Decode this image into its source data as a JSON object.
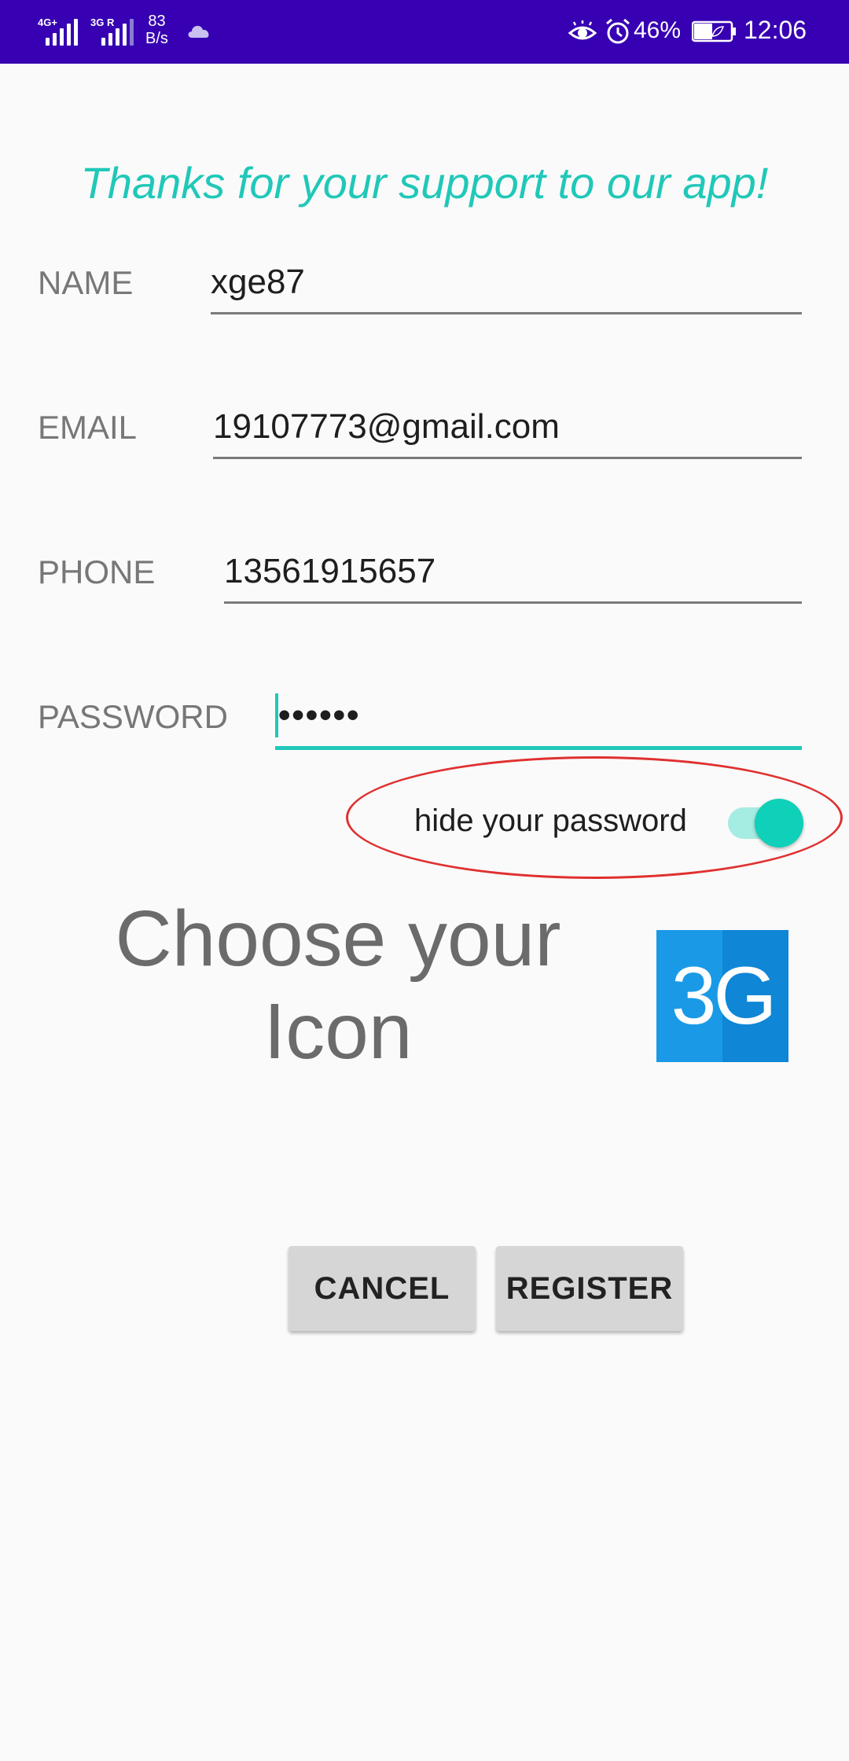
{
  "status_bar": {
    "net1": "4G+",
    "net2": "3G R",
    "speed": "83\nB/s",
    "battery_pct": "46%",
    "time": "12:06",
    "bg_color": "#3700b3",
    "icons": [
      "signal-icon",
      "cloud-icon",
      "eye-icon",
      "alarm-icon",
      "battery-icon"
    ]
  },
  "headline": "Thanks for your support to our app!",
  "form": {
    "name": {
      "label": "NAME",
      "value": "xge87"
    },
    "email": {
      "label": "EMAIL",
      "value": "19107773@gmail.com"
    },
    "phone": {
      "label": "PHONE",
      "value": "13561915657"
    },
    "password": {
      "label": "PASSWORD",
      "value": "••••••"
    }
  },
  "toggle": {
    "label": "hide your password",
    "checked": true
  },
  "choose_icon": {
    "line1": "Choose your",
    "line2": "Icon",
    "icon_text": "3G"
  },
  "buttons": {
    "cancel": "CANCEL",
    "register": "REGISTER"
  },
  "colors": {
    "accent": "#20c8b8",
    "highlight_ring": "#e03030",
    "icon_bg": "#1a9ae6"
  }
}
